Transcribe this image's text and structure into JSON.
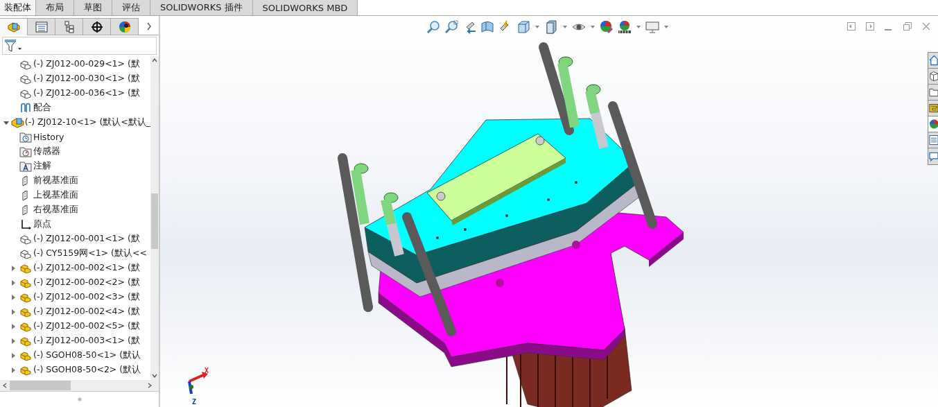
{
  "ribbon_tabs": [
    {
      "label": "装配体",
      "selected": true
    },
    {
      "label": "布局",
      "selected": false
    },
    {
      "label": "草图",
      "selected": false
    },
    {
      "label": "评估",
      "selected": false
    },
    {
      "label": "SOLIDWORKS 插件",
      "selected": false
    },
    {
      "label": "SOLIDWORKS MBD",
      "selected": false
    }
  ],
  "panel_tabs": [
    {
      "kind": "feature-tree",
      "selected": true
    },
    {
      "kind": "property",
      "selected": false
    },
    {
      "kind": "config",
      "selected": false
    },
    {
      "kind": "dimxpert",
      "selected": false
    },
    {
      "kind": "display",
      "selected": false
    }
  ],
  "tree": {
    "continued_children": [
      {
        "label": "(-) ZJ012-00-029<1> (默",
        "kind": "part"
      },
      {
        "label": "(-) ZJ012-00-030<1> (默",
        "kind": "part"
      },
      {
        "label": "(-) ZJ012-00-036<1> (默",
        "kind": "part"
      },
      {
        "label": "配合",
        "kind": "mates"
      }
    ],
    "items": [
      {
        "label": "(-) ZJ012-10<1> (默认<默认_",
        "kind": "assembly",
        "expanded": true,
        "children": [
          {
            "label": "History",
            "kind": "history"
          },
          {
            "label": "传感器",
            "kind": "sensor"
          },
          {
            "label": "注解",
            "kind": "annotation"
          },
          {
            "label": "前视基准面",
            "kind": "plane"
          },
          {
            "label": "上视基准面",
            "kind": "plane"
          },
          {
            "label": "右视基准面",
            "kind": "plane"
          },
          {
            "label": "原点",
            "kind": "origin"
          },
          {
            "label": "(-) ZJ012-00-001<1> (默",
            "kind": "part"
          },
          {
            "label": "(-) CY5159网<1> (默认<<",
            "kind": "part"
          },
          {
            "label": "(-) ZJ012-00-002<1> (默",
            "kind": "subassembly",
            "expanded": false
          },
          {
            "label": "(-) ZJ012-00-002<2> (默",
            "kind": "subassembly",
            "expanded": false
          },
          {
            "label": "(-) ZJ012-00-002<3> (默",
            "kind": "subassembly",
            "expanded": false
          },
          {
            "label": "(-) ZJ012-00-002<4> (默",
            "kind": "subassembly",
            "expanded": false
          },
          {
            "label": "(-) ZJ012-00-002<5> (默",
            "kind": "subassembly",
            "expanded": false
          },
          {
            "label": "(-) ZJ012-00-003<1> (默",
            "kind": "subassembly",
            "expanded": false
          },
          {
            "label": "(-) SGOH08-50<1> (默认",
            "kind": "subassembly",
            "expanded": false
          },
          {
            "label": "(-) SGOH08-50<2> (默认",
            "kind": "subassembly",
            "expanded": false
          }
        ]
      }
    ]
  },
  "view_toolbar": [
    {
      "kind": "zoom-fit"
    },
    {
      "kind": "zoom-area"
    },
    {
      "kind": "previous-view"
    },
    {
      "kind": "section-view"
    },
    {
      "kind": "dynamic-annotation"
    },
    {
      "kind": "view-orientation",
      "dropdown": true
    },
    {
      "kind": "display-style",
      "dropdown": true
    },
    {
      "kind": "hide-show",
      "dropdown": true
    },
    {
      "kind": "edit-appearance"
    },
    {
      "kind": "scene",
      "dropdown": true
    },
    {
      "kind": "view-settings",
      "dropdown": true
    }
  ],
  "task_pane": [
    {
      "kind": "home",
      "selected": false
    },
    {
      "kind": "library",
      "selected": false
    },
    {
      "kind": "explorer",
      "selected": false
    },
    {
      "kind": "palette",
      "selected": false
    },
    {
      "kind": "appearances",
      "selected": true
    },
    {
      "kind": "properties",
      "selected": false
    },
    {
      "kind": "forum",
      "selected": false
    }
  ],
  "triad": {
    "x_label": "X",
    "z_label": "Z"
  }
}
